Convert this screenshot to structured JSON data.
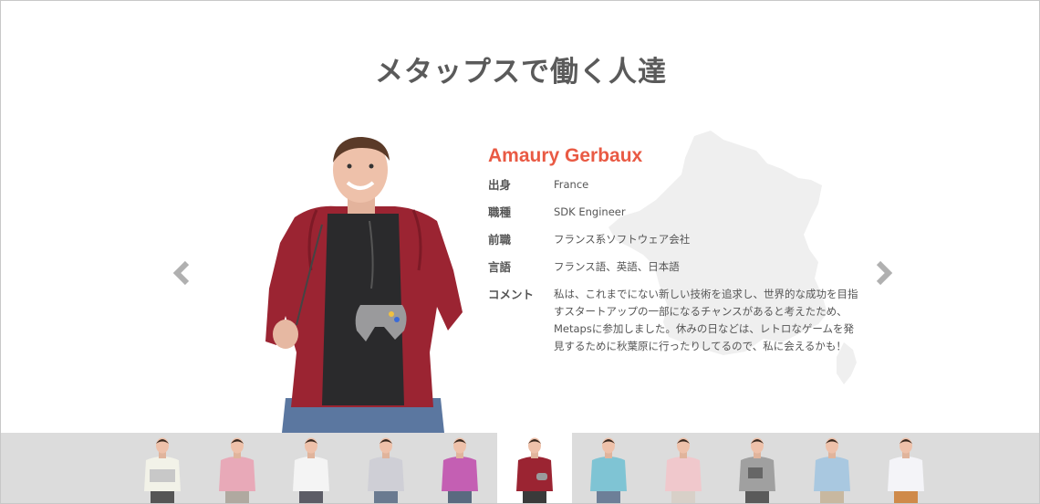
{
  "page": {
    "title": "メタップスで働く人達"
  },
  "profile": {
    "name": "Amaury Gerbaux",
    "fields": [
      {
        "label": "出身",
        "value": "France"
      },
      {
        "label": "職種",
        "value": "SDK Engineer"
      },
      {
        "label": "前職",
        "value": "フランス系ソフトウェア会社"
      },
      {
        "label": "言語",
        "value": "フランス語、英語、日本語"
      },
      {
        "label": "コメント",
        "value": "私は、これまでにない新しい技術を追求し、世界的な成功を目指すスタートアップの一部になるチャンスがあると考えたため、Metapsに参加しました。休みの日などは、レトロなゲームを発見するために秋葉原に行ったりしてるので、私に会えるかも！"
      }
    ]
  },
  "carousel": {
    "prev_icon": "chevron-left-icon",
    "next_icon": "chevron-right-icon",
    "arrow_color": "#b0b0b0"
  },
  "thumbnails": [
    {
      "shirt": "#f2f2e8",
      "pants": "#555",
      "item": "laptop"
    },
    {
      "shirt": "#e8a9b8",
      "pants": "#b0a9a0",
      "item": "none"
    },
    {
      "shirt": "#f4f4f4",
      "pants": "#5c5c66",
      "item": "none"
    },
    {
      "shirt": "#cfcfd6",
      "pants": "#6a7a90",
      "item": "none"
    },
    {
      "shirt": "#c45fb3",
      "pants": "#5a6a80",
      "item": "none"
    },
    {
      "shirt": "#9b2432",
      "pants": "#3a3a3a",
      "item": "controller",
      "active": true
    },
    {
      "shirt": "#7fc4d4",
      "pants": "#6d7f98",
      "item": "none"
    },
    {
      "shirt": "#f0c8cc",
      "pants": "#d8d0c8",
      "item": "none"
    },
    {
      "shirt": "#a0a0a0",
      "pants": "#5a5a5a",
      "item": "tablet"
    },
    {
      "shirt": "#a9c8e0",
      "pants": "#c8b8a0",
      "item": "none"
    },
    {
      "shirt": "#f4f4f8",
      "pants": "#cf8a4a",
      "item": "none"
    }
  ],
  "colors": {
    "accent": "#e95a44",
    "strip_bg": "#dcdcdc",
    "map_fill": "#efefef"
  }
}
